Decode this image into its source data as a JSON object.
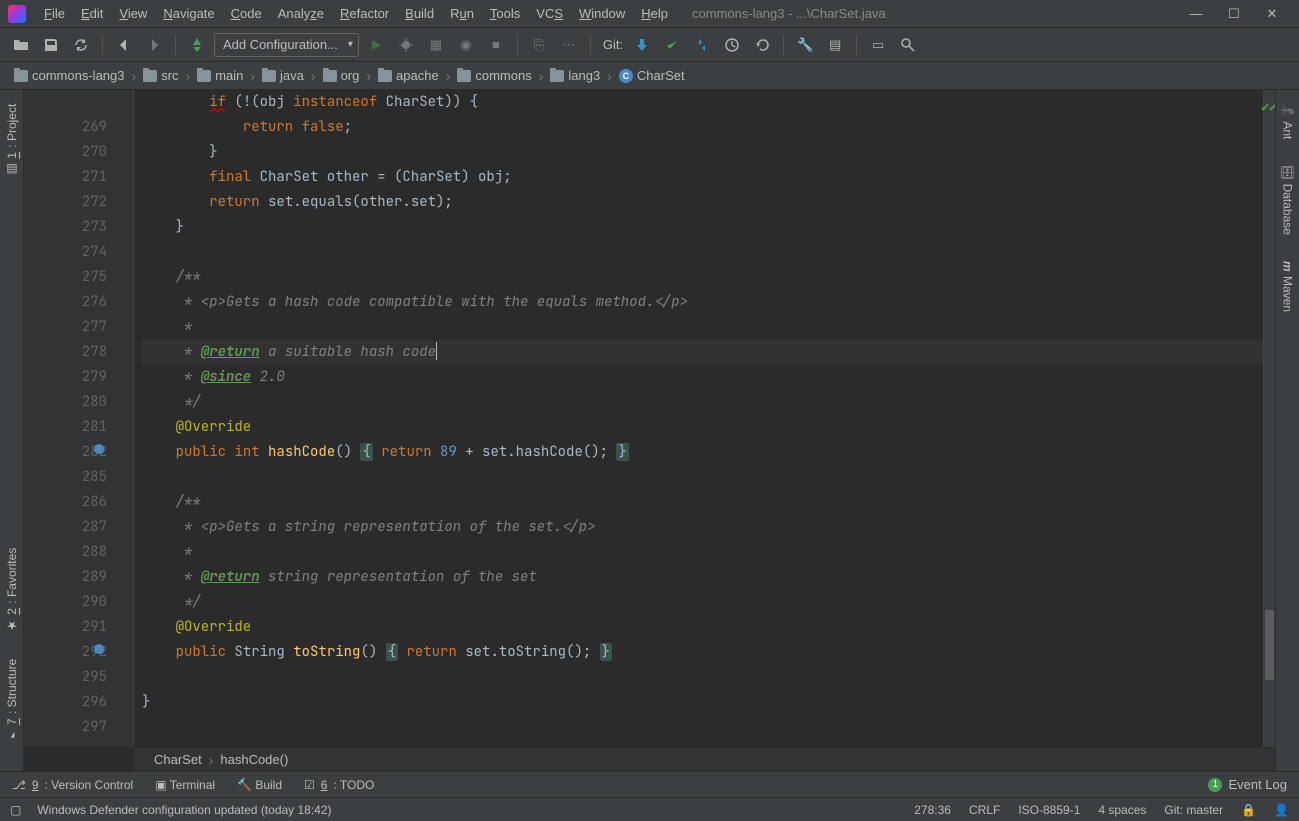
{
  "title_path": "commons-lang3 - ...\\CharSet.java",
  "menus": [
    "File",
    "Edit",
    "View",
    "Navigate",
    "Code",
    "Analyze",
    "Refactor",
    "Build",
    "Run",
    "Tools",
    "VCS",
    "Window",
    "Help"
  ],
  "menu_underlines": [
    "F",
    "E",
    "V",
    "N",
    "C",
    "",
    "R",
    "B",
    "u",
    "T",
    "S",
    "W",
    "H"
  ],
  "toolbar": {
    "config_label": "Add Configuration...",
    "git_label": "Git:"
  },
  "breadcrumbs": [
    "commons-lang3",
    "src",
    "main",
    "java",
    "org",
    "apache",
    "commons",
    "lang3",
    "CharSet"
  ],
  "gutter_lines": [
    "",
    "269",
    "270",
    "271",
    "272",
    "273",
    "274",
    "275",
    "276",
    "277",
    "278",
    "279",
    "280",
    "281",
    "282",
    "285",
    "286",
    "287",
    "288",
    "289",
    "290",
    "291",
    "292",
    "295",
    "296",
    "297"
  ],
  "code_breadcrumb": [
    "CharSet",
    "hashCode()"
  ],
  "left_tabs": [
    "1: Project",
    "2: Favorites",
    "7: Structure"
  ],
  "right_tabs": [
    "Ant",
    "Database",
    "Maven"
  ],
  "bottom_tools": [
    "9: Version Control",
    "Terminal",
    "Build",
    "6: TODO"
  ],
  "event_log": {
    "count": "1",
    "label": "Event Log"
  },
  "status": {
    "message": "Windows Defender configuration updated (today 18:42)",
    "pos": "278:36",
    "le": "CRLF",
    "enc": "ISO-8859-1",
    "indent": "4 spaces",
    "git": "Git: master"
  },
  "code": {
    "l0": "if (!(obj instanceof CharSet)) {",
    "l269_ret": "return ",
    "l269_false": "false",
    "l270": "        }",
    "l271_final": "final ",
    "l271_rest1": "CharSet other = (CharSet) obj;",
    "l272_ret": "return ",
    "l272_rest": "set.equals(other.set);",
    "l273": "    }",
    "l275": "    /**",
    "l276": "     * <p>Gets a hash code compatible with the equals method.</p>",
    "l277": "     *",
    "l278_pre": "     * ",
    "l278_tag": "@return",
    "l278_rest": " a suitable hash code",
    "l279_pre": "     * ",
    "l279_tag": "@since",
    "l279_rest": " 2.0",
    "l280": "     */",
    "l281": "@Override",
    "l282_pub": "public ",
    "l282_int": "int ",
    "l282_name": "hashCode",
    "l282_paren": "() ",
    "l282_lb": "{",
    "l282_ret": " return ",
    "l282_num": "89",
    "l282_rest": " + set.hashCode(); ",
    "l282_rb": "}",
    "l286": "    /**",
    "l287": "     * <p>Gets a string representation of the set.</p>",
    "l288": "     *",
    "l289_pre": "     * ",
    "l289_tag": "@return",
    "l289_rest": " string representation of the set",
    "l290": "     */",
    "l291": "@Override",
    "l292_pub": "public ",
    "l292_str": "String ",
    "l292_name": "toString",
    "l292_paren": "() ",
    "l292_lb": "{",
    "l292_ret": " return ",
    "l292_rest": "set.toString(); ",
    "l292_rb": "}",
    "l296": "}"
  }
}
